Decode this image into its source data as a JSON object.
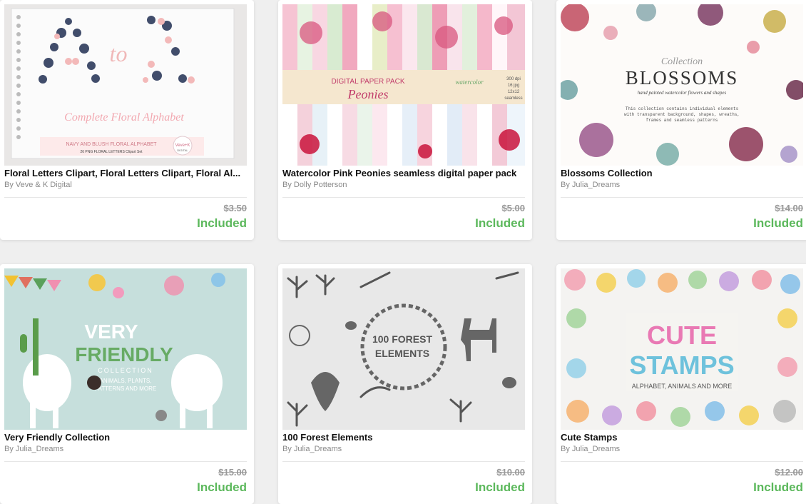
{
  "products": [
    {
      "title": "Floral Letters Clipart, Floral Letters Clipart, Floral Al...",
      "by": "By",
      "author": "Veve & K Digital",
      "old_price": "$3.50",
      "status": "Included",
      "image_text": [
        "A",
        "to",
        "Z",
        "Complete Floral Alphabet",
        "NAVY AND BLUSH FLORAL ALPHABET",
        "26 PNG FLORAL LETTERS Clipart Set",
        "Veve+K",
        "DIGITAL"
      ]
    },
    {
      "title": "Watercolor Pink Peonies seamless digital paper pack",
      "by": "By",
      "author": "Dolly Potterson",
      "old_price": "$5.00",
      "status": "Included",
      "image_text": [
        "DIGITAL PAPER PACK",
        "Peonies",
        "watercolor",
        "300 dpi",
        "16 jpg",
        "12x12",
        "seamless"
      ]
    },
    {
      "title": "Blossoms Collection",
      "by": "By",
      "author": "Julia_Dreams",
      "old_price": "$14.00",
      "status": "Included",
      "image_text": [
        "Collection",
        "BLOSSOMS",
        "hand painted watercolor flowers and shapes",
        "This collection contains individual elements",
        "with transparent background, shapes, wreaths,",
        "frames and seamless patterns"
      ]
    },
    {
      "title": "Very Friendly Collection",
      "by": "By",
      "author": "Julia_Dreams",
      "old_price": "$15.00",
      "status": "Included",
      "image_text": [
        "VERY",
        "FRIENDLY",
        "COLLECTION",
        "ANIMALS, PLANTS,",
        "PATTERNS AND MORE"
      ]
    },
    {
      "title": "100 Forest Elements",
      "by": "By",
      "author": "Julia_Dreams",
      "old_price": "$10.00",
      "status": "Included",
      "image_text": [
        "100 FOREST",
        "ELEMENTS"
      ]
    },
    {
      "title": "Cute Stamps",
      "by": "By",
      "author": "Julia_Dreams",
      "old_price": "$12.00",
      "status": "Included",
      "image_text": [
        "CUTE",
        "STAMPS",
        "ALPHABET, ANIMALS AND MORE"
      ]
    }
  ],
  "colors": {
    "included": "#5cb85c",
    "price": "#999999",
    "title": "#111111",
    "author": "#888888",
    "background": "#efefef"
  }
}
